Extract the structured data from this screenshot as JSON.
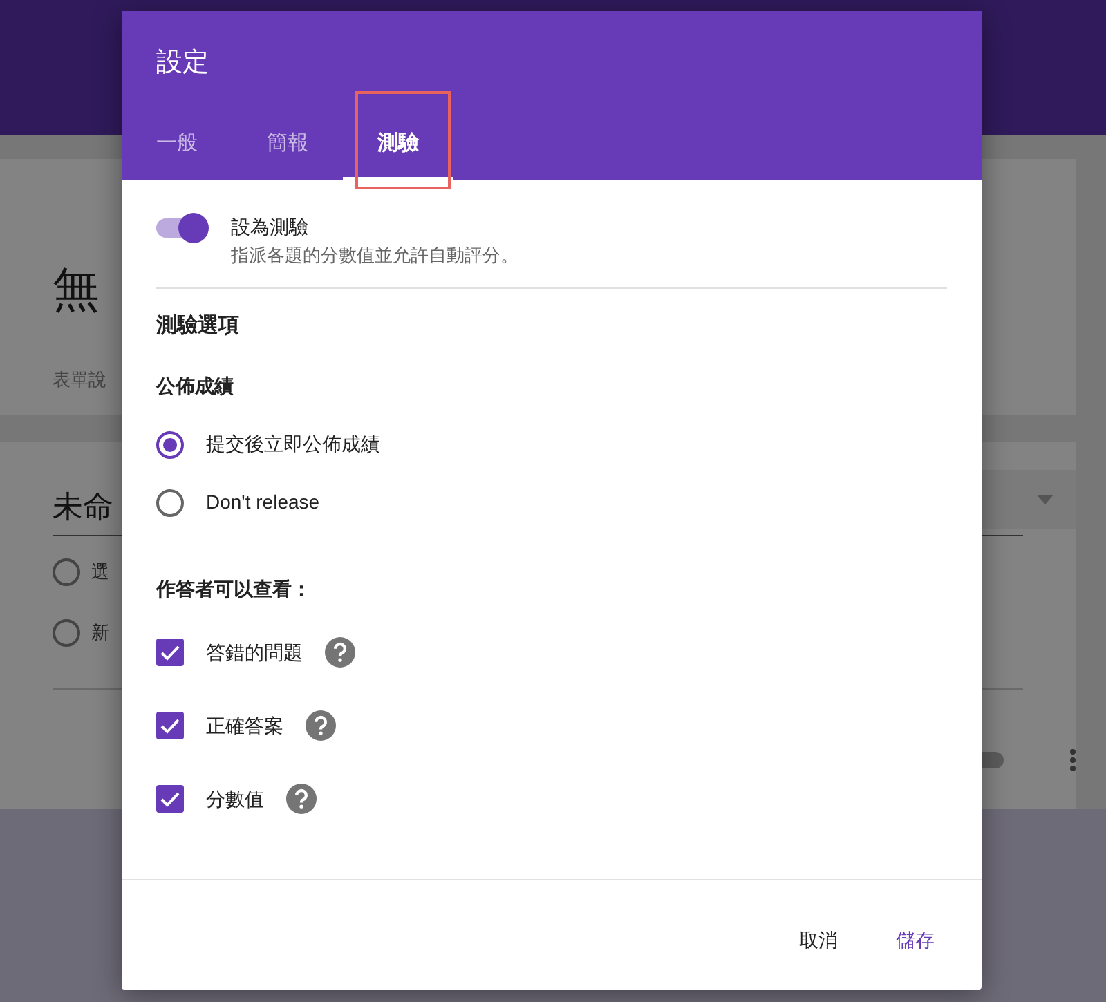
{
  "background_page": {
    "form_title": "無",
    "form_description": "表單說",
    "question_title": "未命",
    "options": [
      {
        "label": "選",
        "selected": false
      },
      {
        "label": "新",
        "selected": false
      }
    ],
    "required_toggle": {
      "on": false
    }
  },
  "dialog": {
    "title": "設定",
    "tabs": [
      {
        "label": "一般",
        "selected": false,
        "highlighted": false
      },
      {
        "label": "簡報",
        "selected": false,
        "highlighted": false
      },
      {
        "label": "測驗",
        "selected": true,
        "highlighted": true
      }
    ],
    "quiz_toggle": {
      "label": "設為測驗",
      "description": "指派各題的分數值並允許自動評分。",
      "on": true
    },
    "section_title": "測驗選項",
    "release": {
      "heading": "公佈成績",
      "options": [
        {
          "label": "提交後立即公佈成績",
          "selected": true
        },
        {
          "label": "Don't release",
          "selected": false
        }
      ]
    },
    "respondent_view": {
      "heading": "作答者可以查看：",
      "items": [
        {
          "label": "答錯的問題",
          "checked": true
        },
        {
          "label": "正確答案",
          "checked": true
        },
        {
          "label": "分數值",
          "checked": true
        }
      ]
    },
    "buttons": [
      {
        "label": "取消",
        "kind": "cancel"
      },
      {
        "label": "儲存",
        "kind": "save"
      }
    ]
  }
}
